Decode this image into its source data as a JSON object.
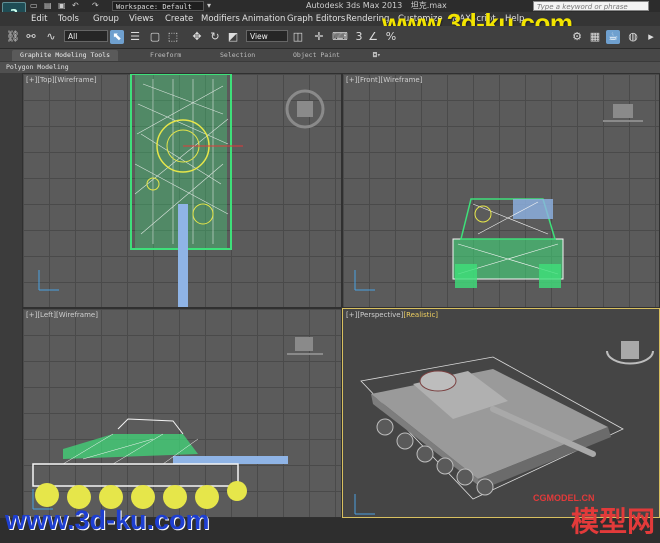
{
  "titlebar": {
    "workspace": "Workspace: Default",
    "title": "Autodesk 3ds Max 2013",
    "filename": "坦克.max",
    "search_placeholder": "Type a keyword or phrase"
  },
  "watermarks": {
    "top": "www.3d-ku.com",
    "bottom": "www.3d-ku.com",
    "cgmodel": "CGMODEL.CN",
    "cn": "模型网"
  },
  "menu": [
    "Edit",
    "Tools",
    "Group",
    "Views",
    "Create",
    "Modifiers",
    "Animation",
    "Graph Editors",
    "Rendering",
    "Customize",
    "MAXScript",
    "Help"
  ],
  "toolbar": {
    "selection_filter": "All",
    "ref_coord": "View",
    "snap_value": "3"
  },
  "ribbon": {
    "tabs": [
      "Graphite Modeling Tools",
      "Freeform",
      "Selection",
      "Object Paint"
    ],
    "panel_label": "Polygon Modeling"
  },
  "viewports": {
    "top": {
      "plus": "[+]",
      "view": "[Top]",
      "shading": "[Wireframe]"
    },
    "front": {
      "plus": "[+]",
      "view": "[Front]",
      "shading": "[Wireframe]"
    },
    "left": {
      "plus": "[+]",
      "view": "[Left]",
      "shading": "[Wireframe]"
    },
    "perspective": {
      "plus": "[+]",
      "view": "[Perspective]",
      "shading": "[Realistic]"
    }
  },
  "colors": {
    "accent_select": "#6fa0cf",
    "wire_green": "#3ee07a",
    "wire_white": "#f4f4f4",
    "wire_yellow": "#e6e64a",
    "wire_blue": "#8fb4e6",
    "active_border": "#d8c060"
  }
}
